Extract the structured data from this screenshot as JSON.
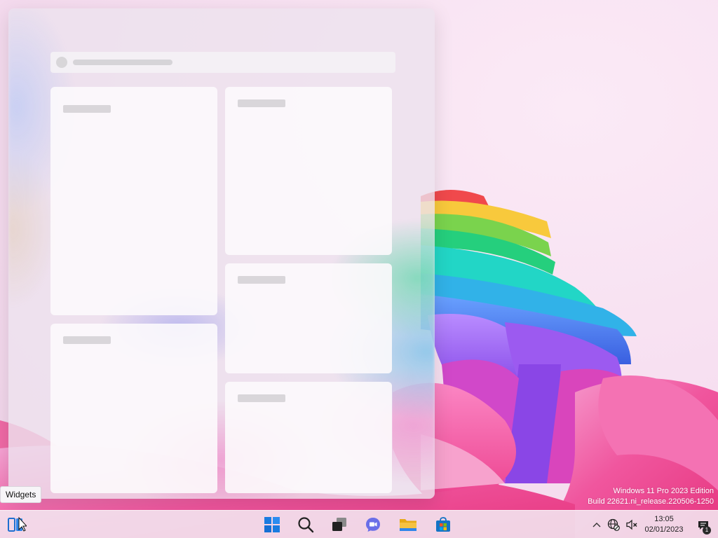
{
  "tooltip": {
    "text": "Widgets"
  },
  "watermark": {
    "line1": "Windows 11 Pro 2023 Edition",
    "line2": "Build 22621.ni_release.220506-1250"
  },
  "taskbar": {
    "items": [
      {
        "name": "widgets",
        "icon": "widgets-icon"
      },
      {
        "name": "start",
        "icon": "windows-logo-icon"
      },
      {
        "name": "search",
        "icon": "search-icon"
      },
      {
        "name": "task-view",
        "icon": "task-view-icon"
      },
      {
        "name": "chat",
        "icon": "teams-chat-icon"
      },
      {
        "name": "file-explorer",
        "icon": "folder-icon"
      },
      {
        "name": "store",
        "icon": "store-icon"
      }
    ]
  },
  "tray": {
    "time": "13:05",
    "date": "02/01/2023",
    "notification_count": "1"
  },
  "colors": {
    "accent": "#0a6cd4",
    "folder": "#f5c242",
    "store": "#1473c5"
  }
}
